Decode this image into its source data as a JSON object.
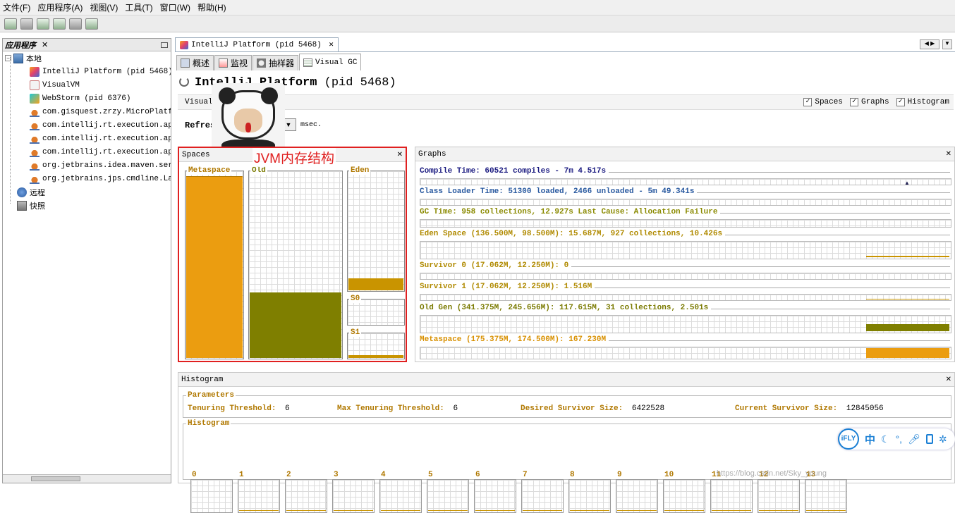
{
  "menu": [
    "文件(F)",
    "应用程序(A)",
    "视图(V)",
    "工具(T)",
    "窗口(W)",
    "帮助(H)"
  ],
  "left_panel": {
    "title": "应用程序",
    "local": "本地",
    "items": [
      {
        "label": "IntelliJ Platform (pid 5468)",
        "icon": "intellij-icon"
      },
      {
        "label": "VisualVM",
        "icon": "visualvm-icon"
      },
      {
        "label": "WebStorm (pid 6376)",
        "icon": "webstorm-icon"
      },
      {
        "label": "com.gisquest.zrzy.MicroPlatfor",
        "icon": "java-icon"
      },
      {
        "label": "com.intellij.rt.execution.appl",
        "icon": "java-icon"
      },
      {
        "label": "com.intellij.rt.execution.appl",
        "icon": "java-icon"
      },
      {
        "label": "com.intellij.rt.execution.appl",
        "icon": "java-icon"
      },
      {
        "label": "org.jetbrains.idea.maven.serve",
        "icon": "java-icon"
      },
      {
        "label": "org.jetbrains.jps.cmdline.Laun",
        "icon": "java-icon"
      }
    ],
    "remote": "远程",
    "snapshot": "快照"
  },
  "doc_tab": "IntelliJ Platform (pid 5468)",
  "subtabs": [
    "概述",
    "监视",
    "抽样器",
    "Visual GC"
  ],
  "header": {
    "title_main": "IntelliJ Platform",
    "title_pid": "(pid 5468)",
    "section": "Visual GC",
    "checkboxes": [
      "Spaces",
      "Graphs",
      "Histogram"
    ],
    "refresh_label": "Refresh rate:",
    "refresh_unit": "msec."
  },
  "annotation": "JVM内存结构",
  "spaces": {
    "title": "Spaces",
    "metaspace": "Metaspace",
    "old": "Old",
    "eden": "Eden",
    "s0": "S0",
    "s1": "S1",
    "fill": {
      "metaspace": 0.97,
      "old": 0.35,
      "eden": 0.1,
      "s0": 0.0,
      "s1": 0.1
    }
  },
  "graphs": {
    "title": "Graphs",
    "lines": [
      {
        "text": "Compile Time: 60521 compiles - 7m 4.517s",
        "color": "#1a1a80"
      },
      {
        "text": "Class Loader Time: 51300 loaded, 2466 unloaded - 5m 49.341s",
        "color": "#2a5aa0"
      },
      {
        "text": "GC Time: 958 collections, 12.927s  Last Cause: Allocation Failure",
        "color": "#8a8a00"
      },
      {
        "text": "Eden Space (136.500M, 98.500M): 15.687M, 927 collections, 10.426s",
        "color": "#b08a00"
      },
      {
        "text": "Survivor 0 (17.062M, 12.250M): 0",
        "color": "#b08a00"
      },
      {
        "text": "Survivor 1 (17.062M, 12.250M): 1.516M",
        "color": "#b08a00"
      },
      {
        "text": "Old Gen (341.375M, 245.656M): 117.615M, 31 collections, 2.501s",
        "color": "#7a7a00"
      },
      {
        "text": "Metaspace (175.375M, 174.500M): 167.230M",
        "color": "#d89000"
      }
    ]
  },
  "histogram": {
    "title": "Histogram",
    "params_title": "Parameters",
    "params": [
      {
        "label": "Tenuring Threshold:",
        "value": "6"
      },
      {
        "label": "Max Tenuring Threshold:",
        "value": "6"
      },
      {
        "label": "Desired Survivor Size:",
        "value": "6422528"
      },
      {
        "label": "Current Survivor Size:",
        "value": "12845056"
      }
    ],
    "hist_title": "Histogram",
    "bins": [
      "0",
      "1",
      "2",
      "3",
      "4",
      "5",
      "6",
      "7",
      "8",
      "9",
      "10",
      "11",
      "12",
      "13"
    ]
  },
  "ifly": {
    "brand": "iFLY",
    "ime": "中"
  },
  "watermark": "https://blog.csdn.net/Sky_young"
}
